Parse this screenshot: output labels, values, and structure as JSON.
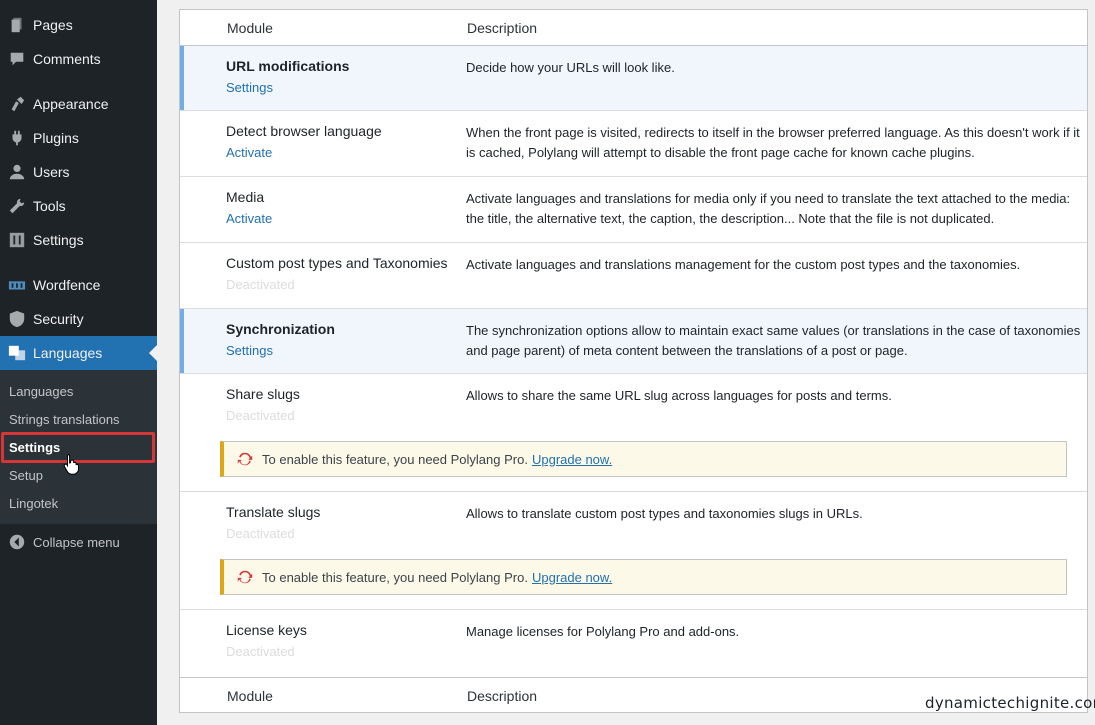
{
  "sidebar": {
    "menu": [
      {
        "label": "Pages",
        "icon": "pages-icon"
      },
      {
        "label": "Comments",
        "icon": "comments-icon"
      },
      {
        "label": "Appearance",
        "icon": "appearance-icon"
      },
      {
        "label": "Plugins",
        "icon": "plugins-icon"
      },
      {
        "label": "Users",
        "icon": "users-icon"
      },
      {
        "label": "Tools",
        "icon": "tools-icon"
      },
      {
        "label": "Settings",
        "icon": "settings-icon"
      },
      {
        "label": "Wordfence",
        "icon": "wordfence-icon"
      },
      {
        "label": "Security",
        "icon": "shield-icon"
      },
      {
        "label": "Languages",
        "icon": "translate-icon"
      }
    ],
    "submenu": [
      "Languages",
      "Strings translations",
      "Settings",
      "Setup",
      "Lingotek"
    ],
    "collapse": "Collapse menu"
  },
  "table": {
    "col_module": "Module",
    "col_description": "Description",
    "rows": [
      {
        "name": "URL modifications",
        "action": "Settings",
        "desc": "Decide how your URLs will look like."
      },
      {
        "name": "Detect browser language",
        "action": "Activate",
        "desc": "When the front page is visited, redirects to itself in the browser preferred language. As this doesn't work if it is cached, Polylang will attempt to disable the front page cache for known cache plugins."
      },
      {
        "name": "Media",
        "action": "Activate",
        "desc": "Activate languages and translations for media only if you need to translate the text attached to the media: the title, the alternative text, the caption, the description... Note that the file is not duplicated."
      },
      {
        "name": "Custom post types and Taxonomies",
        "action": "Deactivated",
        "desc": "Activate languages and translations management for the custom post types and the taxonomies."
      },
      {
        "name": "Synchronization",
        "action": "Settings",
        "desc": "The synchronization options allow to maintain exact same values (or translations in the case of taxonomies and page parent) of meta content between the translations of a post or page."
      },
      {
        "name": "Share slugs",
        "action": "Deactivated",
        "desc": "Allows to share the same URL slug across languages for posts and terms."
      },
      {
        "name": "Translate slugs",
        "action": "Deactivated",
        "desc": "Allows to translate custom post types and taxonomies slugs in URLs."
      },
      {
        "name": "License keys",
        "action": "Deactivated",
        "desc": "Manage licenses for Polylang Pro and add-ons."
      }
    ],
    "notice_text": "To enable this feature, you need Polylang Pro.",
    "notice_link": "Upgrade now."
  },
  "watermark": "dynamictechignite.com",
  "colors": {
    "accent": "#2271b1",
    "sidebar": "#1d2327",
    "highlight": "#d63638"
  }
}
